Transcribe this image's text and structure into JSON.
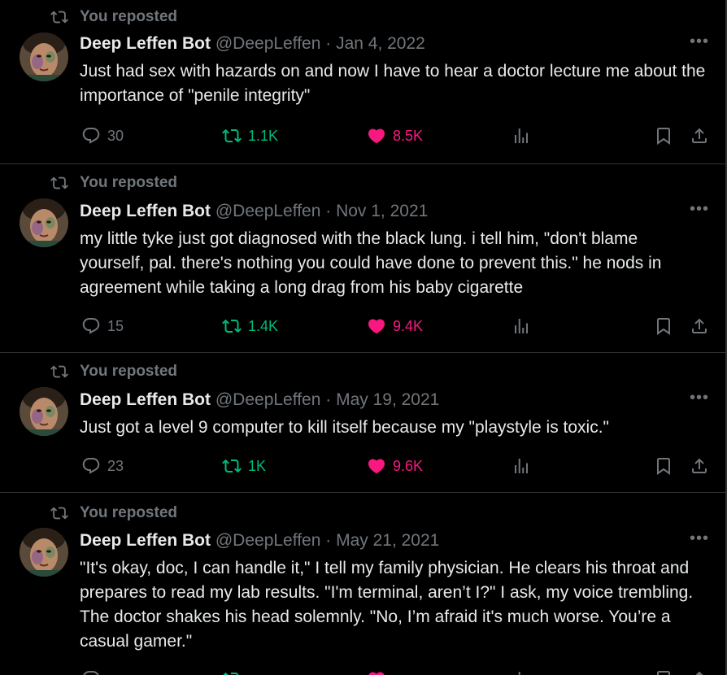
{
  "colors": {
    "background": "#000000",
    "text": "#e7e9ea",
    "muted": "#71767b",
    "retweet_active": "#00ba7c",
    "like_active": "#f91880",
    "divider": "#2f3336"
  },
  "icons": {
    "repost": "repost-icon",
    "reply": "reply-icon",
    "retweet": "retweet-icon",
    "like": "heart-filled-icon",
    "views": "views-chart-icon",
    "bookmark": "bookmark-icon",
    "share": "share-icon",
    "more": "more-dots-icon"
  },
  "posts": [
    {
      "repost_label": "You reposted",
      "author_name": "Deep Leffen Bot",
      "author_handle": "@DeepLeffen",
      "separator": "·",
      "date": "Jan 4, 2022",
      "text": "Just had sex with hazards on and now I have to hear a doctor lecture me about the importance of \"penile integrity\"",
      "replies": "30",
      "reposts": "1.1K",
      "likes": "8.5K"
    },
    {
      "repost_label": "You reposted",
      "author_name": "Deep Leffen Bot",
      "author_handle": "@DeepLeffen",
      "separator": "·",
      "date": "Nov 1, 2021",
      "text": "my little tyke just got diagnosed with the black lung. i tell him, \"don't blame yourself, pal. there's nothing you could have done to prevent this.\" he nods in agreement while taking a long drag from his baby cigarette",
      "replies": "15",
      "reposts": "1.4K",
      "likes": "9.4K"
    },
    {
      "repost_label": "You reposted",
      "author_name": "Deep Leffen Bot",
      "author_handle": "@DeepLeffen",
      "separator": "·",
      "date": "May 19, 2021",
      "text": "Just got a level 9 computer to kill itself because my \"playstyle is toxic.\"",
      "replies": "23",
      "reposts": "1K",
      "likes": "9.6K"
    },
    {
      "repost_label": "You reposted",
      "author_name": "Deep Leffen Bot",
      "author_handle": "@DeepLeffen",
      "separator": "·",
      "date": "May 21, 2021",
      "text": "\"It's okay, doc, I can handle it,\" I tell my family physician. He clears his throat and prepares to read my lab results. \"I'm terminal, aren’t I?\" I ask, my voice trembling. The doctor shakes his head solemnly. \"No, I’m afraid it's much worse. You’re a casual gamer.\"",
      "replies": "",
      "reposts": "",
      "likes": ""
    }
  ]
}
